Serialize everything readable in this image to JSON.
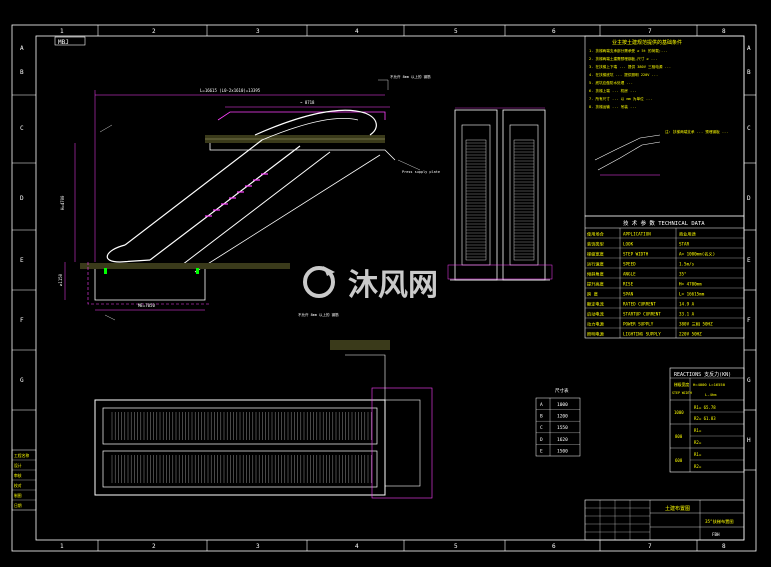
{
  "sheet": {
    "top_numbers": [
      "1",
      "2",
      "3",
      "4",
      "5",
      "6",
      "7",
      "8"
    ],
    "bottom_numbers": [
      "1",
      "2",
      "3",
      "4",
      "5",
      "6",
      "7",
      "8"
    ],
    "right_letters": [
      "A",
      "B",
      "C",
      "D",
      "E",
      "F",
      "G",
      "H"
    ],
    "left_letters": [
      "A",
      "B",
      "C",
      "D",
      "E",
      "F",
      "G",
      "H"
    ],
    "corner_tag": "MBJ"
  },
  "general_notes": {
    "title": "业主按土建规范提供的基础条件",
    "lines": [
      "1. 扶梯两端支承部分需承受 ≥ 5t 的荷载;...",
      "2. 扶梯两端土建需预埋钢板,尺寸 ≥ ...",
      "3. 在扶梯上下端 ... 提供 380V 三相电源 ...",
      "4. 在扶梯底坑 ... 提供照明 220V ...",
      "5. 底坑应做防水处理 ...",
      "6. 扶梯上端 ... 机房 ...",
      "7. 所有尺寸 ... 以 mm 为单位 ...",
      "8. 扶梯运输 ... 吊装 ..."
    ]
  },
  "detail_note": "注: 扶梯两端支承 ... 预埋钢板 ...",
  "tech_data": {
    "title": "技 术 参 数  TECHNICAL DATA",
    "rows": [
      {
        "cn": "使用场合",
        "en": "APPLICATION",
        "val": "商业用途"
      },
      {
        "cn": "装饰类型",
        "en": "LOOK",
        "val": "STAR"
      },
      {
        "cn": "梯级宽度",
        "en": "STEP WIDTH",
        "val": "A= 1000mm(名义)"
      },
      {
        "cn": "运行速度",
        "en": "SPEED",
        "val": "1.5m/s"
      },
      {
        "cn": "倾斜角度",
        "en": "ANGLE",
        "val": "35°"
      },
      {
        "cn": "提升高度",
        "en": "RISE",
        "val": "H= 4700mm"
      },
      {
        "cn": "跨    度",
        "en": "SPAN",
        "val": "L= 16615mm"
      },
      {
        "cn": "额定电流",
        "en": "RATED CURRENT",
        "val": "14.9 A"
      },
      {
        "cn": "启动电流",
        "en": "STARTUP CURRENT",
        "val": "33.1 A"
      },
      {
        "cn": "动力电源",
        "en": "POWER SUPPLY",
        "val": "380V 三相 50HZ"
      },
      {
        "cn": "照明电源",
        "en": "LIGHTING SUPPLY",
        "val": "220V 50HZ"
      }
    ]
  },
  "reactions": {
    "title": "REACTIONS 支反力(KN)",
    "col1": "梯级宽度",
    "col1b": "STEP WIDTH",
    "col2": "H=4000 L=16550",
    "col2b": "L-4hm",
    "rows": [
      {
        "w": "1000",
        "r1": "R1= 65.78",
        "r2": "R2= 61.83"
      },
      {
        "w": "800",
        "r1": "R1=",
        "r2": "R2="
      },
      {
        "w": "600",
        "r1": "R1=",
        "r2": "R2="
      }
    ]
  },
  "width_table": {
    "title": "尺寸表",
    "rows": [
      {
        "k": "A",
        "v": "1000"
      },
      {
        "k": "B",
        "v": "1200"
      },
      {
        "k": "C",
        "v": "1550"
      },
      {
        "k": "D",
        "v": "1620"
      },
      {
        "k": "E",
        "v": "1500"
      }
    ]
  },
  "left_title_block": [
    "工程名称",
    "设计",
    "审核",
    "校对",
    "制图",
    "日期"
  ],
  "title_block": {
    "drawing_title": "土建布置图",
    "model": "35°扶梯布置图",
    "code": "FBH"
  },
  "dimensions": {
    "overall_top": "L=16615 (L0-2x1610)=13395",
    "span_r": "~ 8718",
    "rise": "H=4700",
    "pit_depth": "≥1150",
    "pit_length": "ME=7050",
    "support_upper": "不允许 8mm 以上的 钢筋",
    "support_lower": "Press supply plate"
  },
  "watermark": {
    "text": "沐风网"
  }
}
